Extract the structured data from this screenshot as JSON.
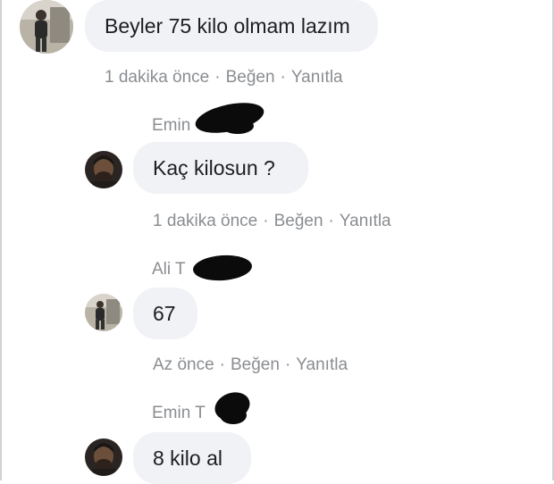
{
  "comment": {
    "text": "Beyler 75 kilo olmam lazım",
    "time": "1 dakika önce",
    "like": "Beğen",
    "reply": "Yanıtla"
  },
  "replies": [
    {
      "author_visible": "Emin",
      "text": "Kaç kilosun ?",
      "time": "1 dakika önce",
      "like": "Beğen",
      "reply": "Yanıtla"
    },
    {
      "author_visible": "Ali T",
      "author_tail": "u",
      "text": "67",
      "time": "Az önce",
      "like": "Beğen",
      "reply": "Yanıtla"
    },
    {
      "author_visible": "Emin T",
      "author_tail": "y",
      "text": "8 kilo al"
    }
  ],
  "separator": "·",
  "icons": {
    "avatar_main": "user-photo-icon",
    "avatar_emin": "user-photo-icon",
    "avatar_ali": "user-photo-icon"
  },
  "colors": {
    "bubble_bg": "#f0f2f5",
    "meta_text": "#8a8d91",
    "body_text": "#1c1e21"
  }
}
